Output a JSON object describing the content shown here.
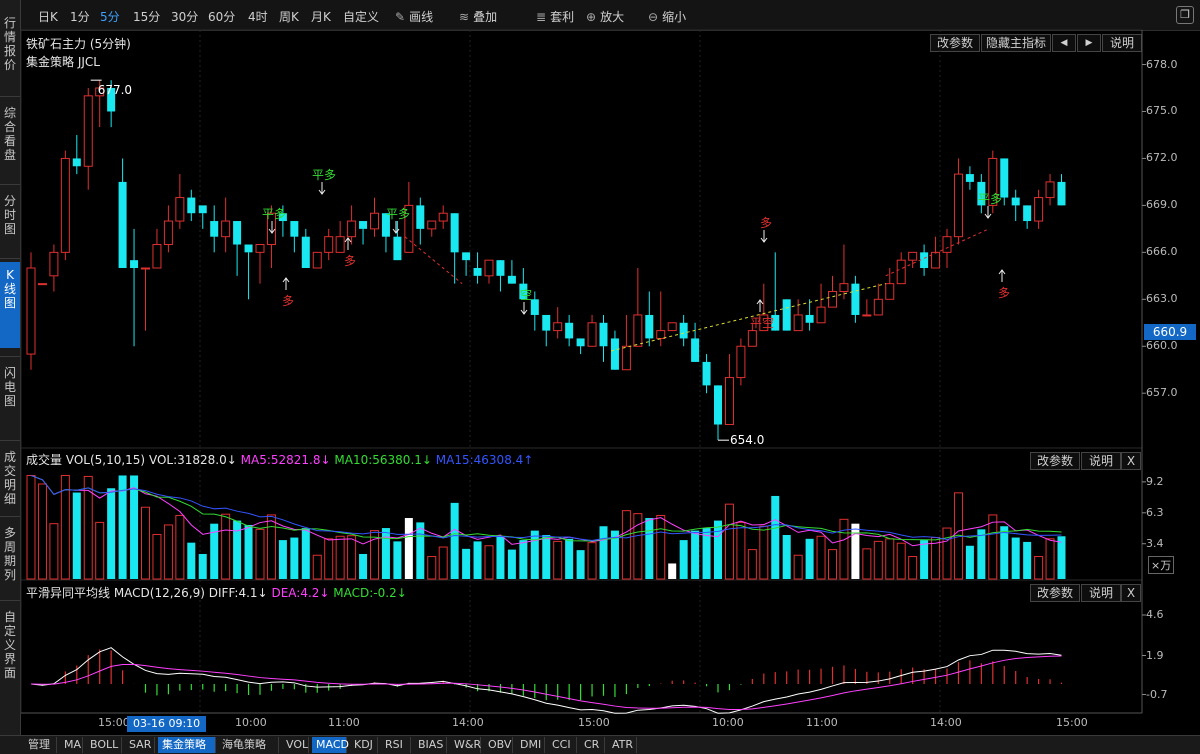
{
  "sidebar": {
    "items": [
      {
        "label": "行情报价",
        "name": "sidebar-item-quote"
      },
      {
        "label": "综合看盘",
        "name": "sidebar-item-overview"
      },
      {
        "label": "分时图",
        "name": "sidebar-item-timeshare"
      },
      {
        "label": "K线图",
        "name": "sidebar-item-kline",
        "active": true
      },
      {
        "label": "闪电图",
        "name": "sidebar-item-flash"
      },
      {
        "label": "成交明细",
        "name": "sidebar-item-trades"
      },
      {
        "label": "多周期列",
        "name": "sidebar-item-multiperiod"
      },
      {
        "label": "自定义界面",
        "name": "sidebar-item-custom"
      }
    ]
  },
  "toolbar": {
    "periods": [
      {
        "label": "日K"
      },
      {
        "label": "1分"
      },
      {
        "label": "5分",
        "active": true
      },
      {
        "label": "15分"
      },
      {
        "label": "30分"
      },
      {
        "label": "60分"
      },
      {
        "label": "4时"
      },
      {
        "label": "周K"
      },
      {
        "label": "月K"
      },
      {
        "label": "自定义"
      }
    ],
    "draw_label": "画线",
    "overlay_label": "叠加",
    "arbitrage_label": "套利",
    "zoom_in_label": "放大",
    "zoom_out_label": "缩小",
    "window_icon": "restore-icon"
  },
  "main_panel": {
    "title": "铁矿石主力 (5分钟)",
    "strategy": "集金策略 JJCL",
    "buttons": {
      "params": "改参数",
      "hide": "隐藏主指标",
      "prev": "◀",
      "next": "▶",
      "help": "说明"
    },
    "high_label": "677.0",
    "low_label": "654.0",
    "current_price": "660.9",
    "y_ticks": [
      "678.0",
      "675.0",
      "672.0",
      "669.0",
      "666.0",
      "663.0",
      "660.0",
      "657.0"
    ],
    "annotations": [
      {
        "text": "平多",
        "kind": "close-long"
      },
      {
        "text": "多",
        "kind": "long"
      },
      {
        "text": "平多",
        "kind": "close-long"
      },
      {
        "text": "多",
        "kind": "long"
      },
      {
        "text": "平多",
        "kind": "close-long"
      },
      {
        "text": "空",
        "kind": "short"
      },
      {
        "text": "多",
        "kind": "long"
      },
      {
        "text": "平空",
        "kind": "close-short"
      },
      {
        "text": "平多",
        "kind": "close-long"
      },
      {
        "text": "多",
        "kind": "long"
      }
    ]
  },
  "volume_panel": {
    "title": "成交量 VOL(5,10,15)",
    "vol": "VOL:31828.0↓",
    "ma5": "MA5:52821.8↓",
    "ma10": "MA10:56380.1↓",
    "ma15": "MA15:46308.4↑",
    "buttons": {
      "params": "改参数",
      "help": "说明",
      "close": "X"
    },
    "y_ticks": [
      "9.2",
      "6.3",
      "3.4"
    ],
    "unit": "×万"
  },
  "macd_panel": {
    "title": "平滑异同平均线 MACD(12,26,9)",
    "diff": "DIFF:4.1↓",
    "dea": "DEA:4.2↓",
    "macd": "MACD:-0.2↓",
    "buttons": {
      "params": "改参数",
      "help": "说明",
      "close": "X"
    },
    "y_ticks": [
      "4.6",
      "1.9",
      "-0.7"
    ]
  },
  "time_axis": {
    "labels": [
      "15:00",
      "10:00",
      "11:00",
      "14:00",
      "15:00",
      "10:00",
      "11:00",
      "14:00",
      "15:00"
    ],
    "cursor_label": "03-16 09:10"
  },
  "bottom_tabs": [
    {
      "label": "管理"
    },
    {
      "label": "MA"
    },
    {
      "label": "BOLL"
    },
    {
      "label": "SAR"
    },
    {
      "label": "集金策略",
      "active": true
    },
    {
      "label": "海龟策略"
    },
    {
      "label": "VOL"
    },
    {
      "label": "MACD",
      "active": true
    },
    {
      "label": "KDJ"
    },
    {
      "label": "RSI"
    },
    {
      "label": "BIAS"
    },
    {
      "label": "W&R"
    },
    {
      "label": "OBV"
    },
    {
      "label": "DMI"
    },
    {
      "label": "CCI"
    },
    {
      "label": "CR"
    },
    {
      "label": "ATR"
    }
  ],
  "colors": {
    "up": "#e0302f",
    "down": "#19e8f0",
    "ma5": "#ff40ff",
    "ma10": "#33dd33",
    "ma15": "#3355ff",
    "white": "#ffffff",
    "accent": "#1268c4"
  },
  "chart_data": {
    "type": "candlestick",
    "period": "5分",
    "bar_count": 91,
    "y_range": [
      653.5,
      678.8
    ],
    "candles": [
      [
        659.5,
        665,
        658.5,
        666
      ],
      [
        664,
        664,
        664.5,
        664.5
      ],
      [
        664.5,
        666,
        663.5,
        666.5
      ],
      [
        666,
        672,
        665.5,
        672.5
      ],
      [
        672,
        671.5,
        671,
        673.5
      ],
      [
        671.5,
        676,
        670,
        676.5
      ],
      [
        676,
        676.5,
        674,
        677
      ],
      [
        676.5,
        675,
        674,
        677
      ],
      [
        670.5,
        665,
        665,
        672
      ],
      [
        665.5,
        665,
        660,
        667.5
      ],
      [
        665,
        665,
        661,
        665
      ],
      [
        665,
        666.5,
        665,
        667.5
      ],
      [
        666.5,
        668,
        666,
        669
      ],
      [
        668,
        669.5,
        667.5,
        671
      ],
      [
        669.5,
        668.5,
        668,
        670
      ],
      [
        669,
        668.5,
        667.5,
        668.5
      ],
      [
        668,
        667,
        666,
        669
      ],
      [
        667,
        668,
        666,
        669.5
      ],
      [
        668,
        666.5,
        664.5,
        668
      ],
      [
        666.5,
        666,
        663,
        666
      ],
      [
        666,
        666.5,
        664,
        666.5
      ],
      [
        666.5,
        668.5,
        665,
        669
      ],
      [
        668.5,
        668,
        667,
        669
      ],
      [
        668,
        667,
        666,
        668
      ],
      [
        667,
        665,
        665,
        667.5
      ],
      [
        665,
        666,
        665,
        666
      ],
      [
        666,
        667,
        665.5,
        667.5
      ],
      [
        666,
        667,
        666,
        668
      ],
      [
        667,
        668,
        666.5,
        669
      ],
      [
        668,
        667.5,
        666.5,
        667.5
      ],
      [
        667.5,
        668.5,
        667,
        669.5
      ],
      [
        668.5,
        667,
        666,
        668.5
      ],
      [
        667,
        665.5,
        666,
        668
      ],
      [
        666,
        669,
        667,
        670.5
      ],
      [
        669,
        667.5,
        666.5,
        669.5
      ],
      [
        667.5,
        668,
        667,
        668
      ],
      [
        668,
        668.5,
        667.5,
        669
      ],
      [
        668.5,
        666,
        664,
        668.5
      ],
      [
        666,
        665.5,
        664.5,
        665.5
      ],
      [
        665,
        664.5,
        664,
        666
      ],
      [
        664.5,
        665.5,
        664,
        665.5
      ],
      [
        665.5,
        664.5,
        663.5,
        665.5
      ],
      [
        664.5,
        664,
        664,
        665.5
      ],
      [
        664,
        663,
        663,
        665
      ],
      [
        663,
        662,
        661,
        663.5
      ],
      [
        662,
        661,
        660,
        662
      ],
      [
        661,
        661.5,
        660.5,
        662.5
      ],
      [
        661.5,
        660.5,
        660,
        662
      ],
      [
        660.5,
        660,
        659.5,
        660.5
      ],
      [
        660,
        661.5,
        660,
        662
      ],
      [
        661.5,
        660,
        659,
        662
      ],
      [
        660.5,
        658.5,
        658.5,
        661
      ],
      [
        658.5,
        660,
        658.5,
        662
      ],
      [
        660,
        662,
        661,
        665
      ],
      [
        662,
        660.5,
        660,
        663.5
      ],
      [
        660.5,
        661,
        660,
        663.5
      ],
      [
        661,
        661.5,
        661,
        661.5
      ],
      [
        661.5,
        660.5,
        660,
        662
      ],
      [
        660.5,
        659,
        659,
        661.5
      ],
      [
        659,
        657.5,
        657,
        659.5
      ],
      [
        657.5,
        655,
        654,
        657.5
      ],
      [
        655,
        658,
        655,
        659.5
      ],
      [
        658,
        660,
        657.5,
        660.5
      ],
      [
        660,
        661,
        660,
        661.5
      ],
      [
        661,
        662,
        661,
        664
      ],
      [
        662,
        661,
        661,
        666
      ],
      [
        663,
        661,
        661,
        663
      ],
      [
        661,
        662,
        662,
        663
      ],
      [
        662,
        661.5,
        661,
        663
      ],
      [
        661.5,
        662.5,
        662,
        664
      ],
      [
        662.5,
        663.5,
        663,
        664.5
      ],
      [
        663.5,
        664,
        663,
        666.5
      ],
      [
        664,
        662,
        661.5,
        664.5
      ],
      [
        662,
        662,
        662,
        663
      ],
      [
        662,
        663,
        662,
        664
      ],
      [
        663,
        664,
        663,
        665
      ],
      [
        664,
        665.5,
        664.5,
        666
      ],
      [
        665.5,
        666,
        665,
        666
      ],
      [
        666,
        665,
        664.5,
        666.5
      ],
      [
        665,
        666,
        665,
        667
      ],
      [
        666,
        667,
        665,
        667.5
      ],
      [
        667,
        671,
        666.5,
        672
      ],
      [
        671,
        670.5,
        670,
        671.5
      ],
      [
        670.5,
        669,
        668.5,
        671
      ],
      [
        669,
        672,
        668.5,
        672.5
      ],
      [
        672,
        669.5,
        669,
        672
      ],
      [
        669.5,
        669,
        668,
        670
      ],
      [
        669,
        668,
        667.5,
        669
      ],
      [
        668,
        669.5,
        667.5,
        670
      ],
      [
        669.5,
        670.5,
        669,
        671
      ],
      [
        670.5,
        669,
        669,
        671
      ]
    ],
    "volume_y_ticks": [
      9.2,
      6.3,
      3.4
    ],
    "macd_y_ticks": [
      4.6,
      1.9,
      -0.7
    ]
  }
}
